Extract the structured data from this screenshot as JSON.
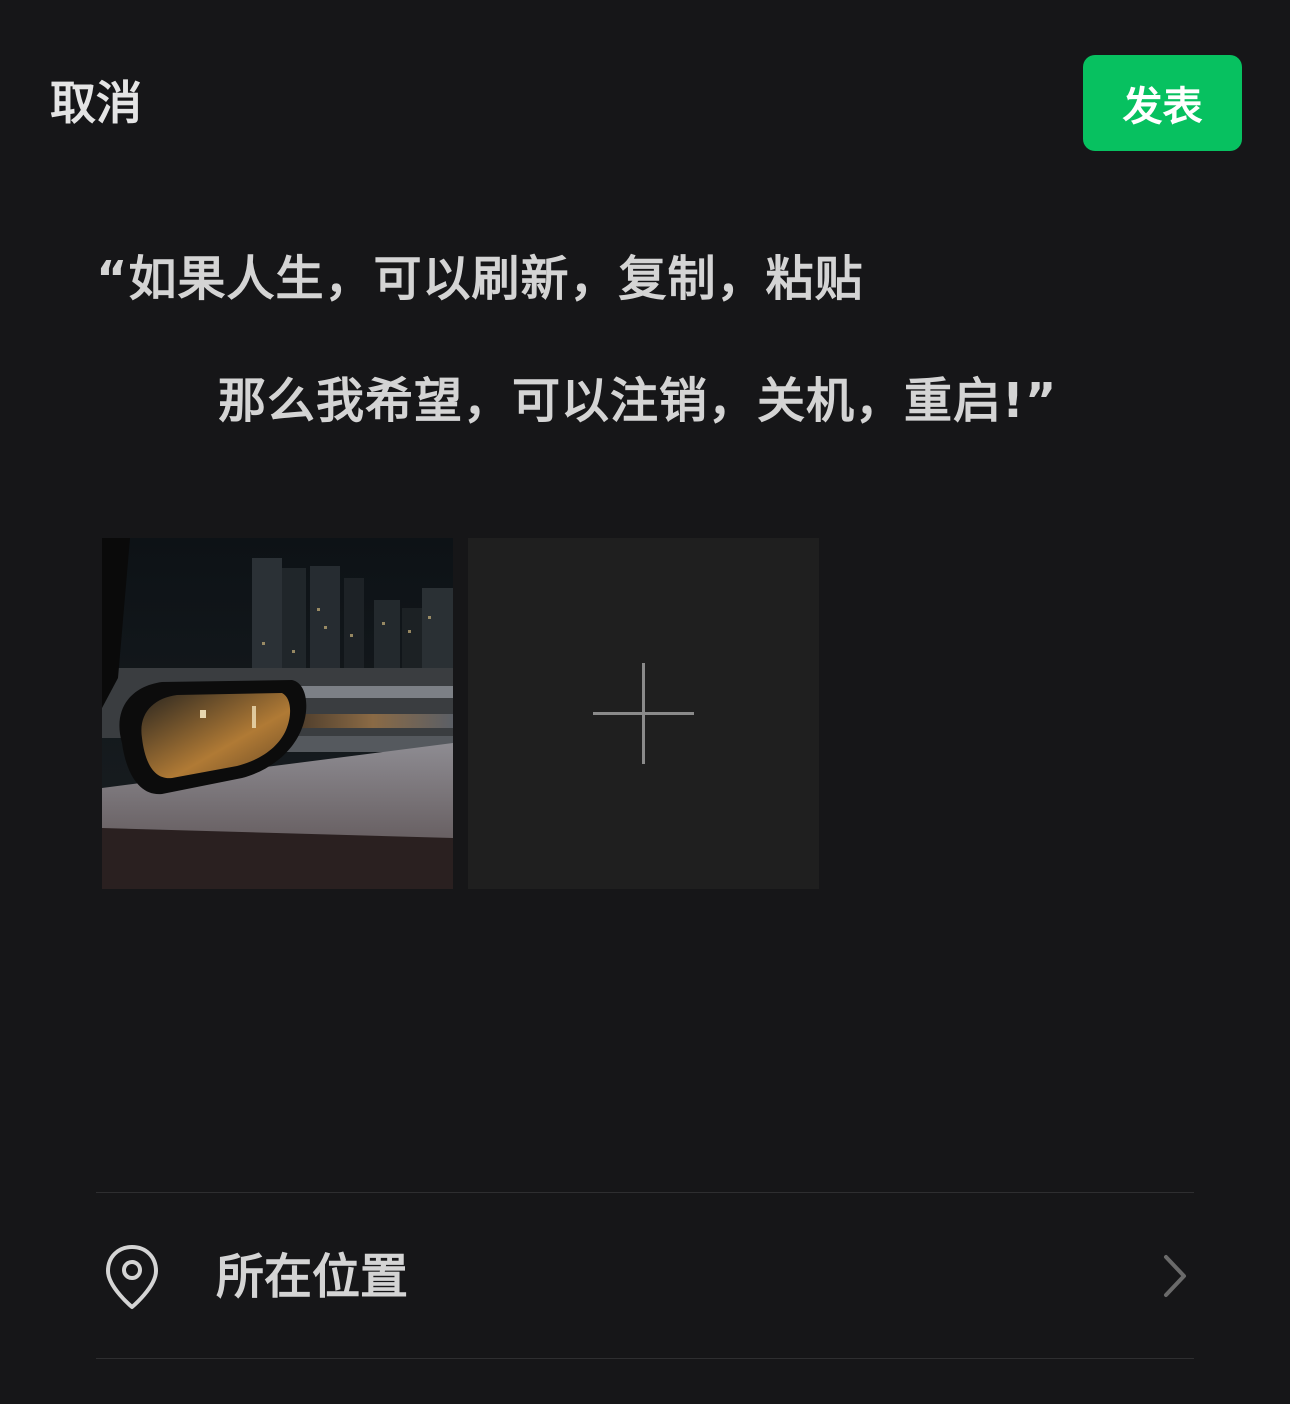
{
  "header": {
    "cancel_label": "取消",
    "publish_label": "发表"
  },
  "post": {
    "line1": "“如果人生，可以刷新，复制，粘贴",
    "line2": "那么我希望，可以注销，关机，重启!”"
  },
  "media": {
    "photo_icon": "night-car-mirror-photo",
    "add_icon": "plus-icon"
  },
  "location": {
    "icon": "location-pin-icon",
    "label": "所在位置",
    "chevron_icon": "chevron-right-icon"
  },
  "colors": {
    "background": "#161618",
    "accent": "#07c160",
    "tile": "#1f1f1f",
    "text": "#d4d4d4"
  }
}
